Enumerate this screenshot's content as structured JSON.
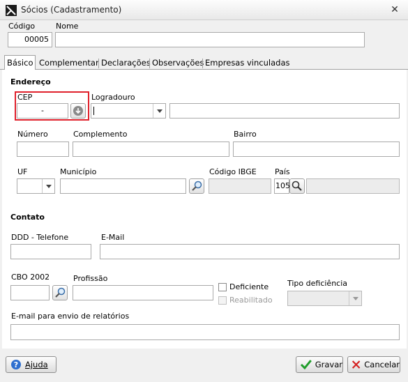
{
  "window": {
    "title": "Sócios (Cadastramento)",
    "close_glyph": "✕"
  },
  "header": {
    "codigo_label": "Código",
    "codigo_value": "00005",
    "nome_label": "Nome",
    "nome_value": ""
  },
  "tabs": [
    {
      "label": "Básico",
      "active": true
    },
    {
      "label": "Complementar"
    },
    {
      "label": "Declarações"
    },
    {
      "label": "Observações"
    },
    {
      "label": "Empresas vinculadas"
    }
  ],
  "endereco": {
    "section_label": "Endereço",
    "cep_label": "CEP",
    "cep_value": "-",
    "logradouro_label": "Logradouro",
    "numero_label": "Número",
    "complemento_label": "Complemento",
    "bairro_label": "Bairro",
    "uf_label": "UF",
    "municipio_label": "Município",
    "codigo_ibge_label": "Código IBGE",
    "pais_label": "País",
    "pais_value": "105"
  },
  "contato": {
    "section_label": "Contato",
    "ddd_label": "DDD - Telefone",
    "email_label": "E-Mail",
    "cbo_label": "CBO 2002",
    "profissao_label": "Profissão",
    "deficiente_label": "Deficiente",
    "reabilitado_label": "Reabilitado",
    "tipo_deficiencia_label": "Tipo deficiência",
    "email_relatorios_label": "E-mail para envio de relatórios"
  },
  "footer": {
    "ajuda_label": "Ajuda",
    "gravar_label": "Gravar",
    "cancelar_label": "Cancelar"
  },
  "colors": {
    "highlight": "#e0202b",
    "panel_bg": "#ffffff",
    "window_bg": "#f0f0f0"
  }
}
